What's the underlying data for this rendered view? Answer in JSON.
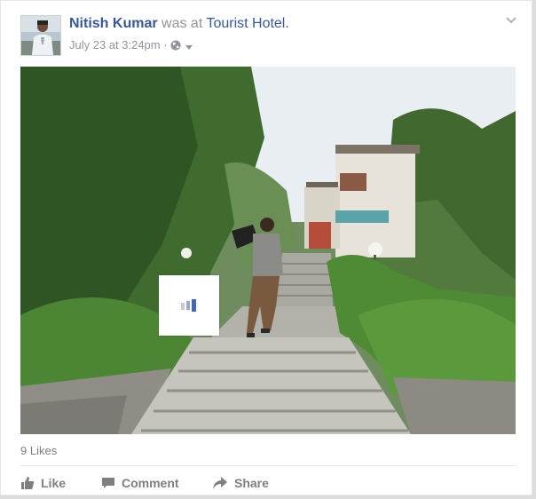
{
  "post": {
    "author": "Nitish Kumar",
    "action_text": "was at",
    "place": "Tourist Hotel.",
    "timestamp": "July 23 at 3:24pm",
    "separator": "·",
    "audience_icon": "globe-icon",
    "menu_icon": "chevron-down-icon"
  },
  "photo": {
    "loading_icon": "loading-bars-icon"
  },
  "stats": {
    "likes": "9 Likes"
  },
  "actions": {
    "like": "Like",
    "comment": "Comment",
    "share": "Share"
  },
  "colors": {
    "link": "#365899",
    "meta": "#90949c",
    "action": "#7f7f7f",
    "loader_accent": "#4267b2"
  }
}
